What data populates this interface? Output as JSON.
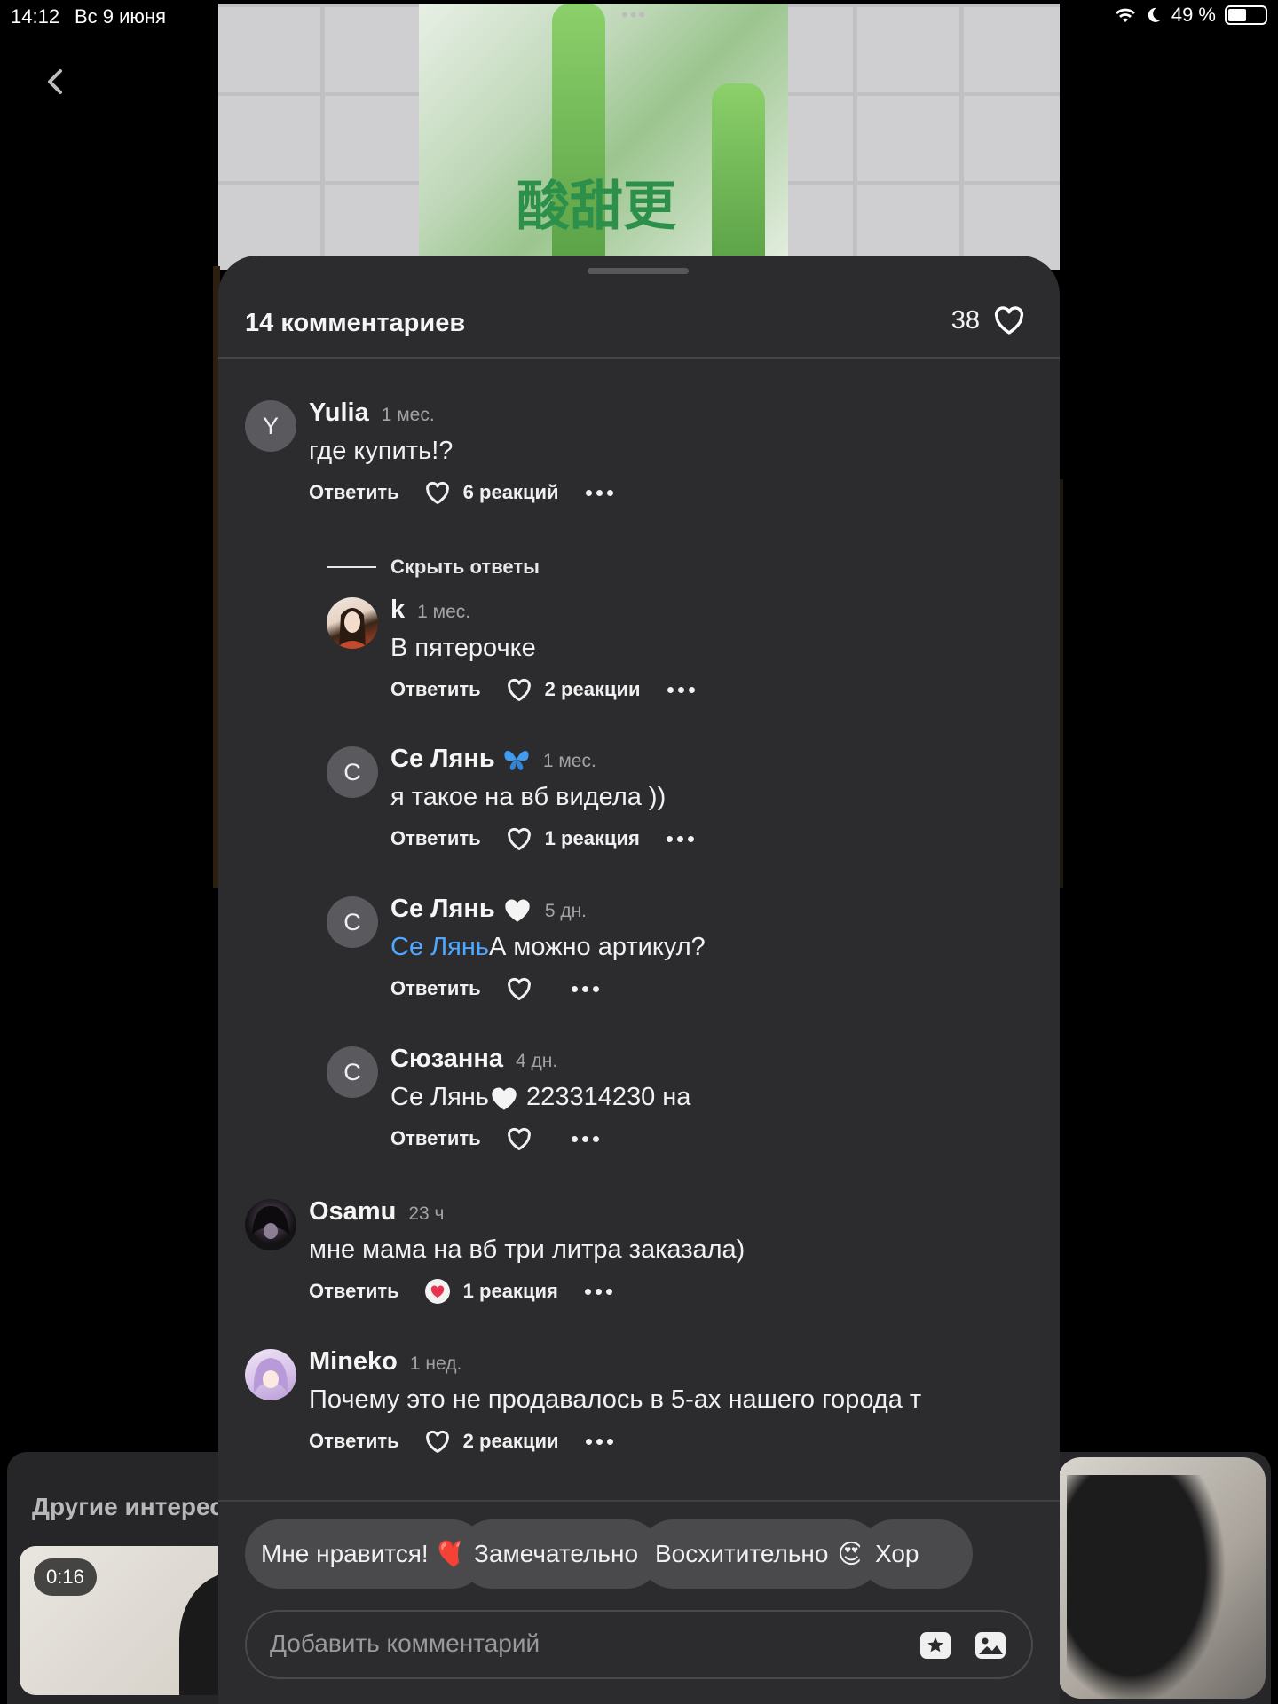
{
  "status_bar": {
    "time": "14:12",
    "date": "Вс 9 июня",
    "battery": "49 %"
  },
  "comments_sheet": {
    "title": "14 комментариев",
    "likes": "38",
    "hide_replies": "Скрыть ответы",
    "reply_label": "Ответить",
    "comments": [
      {
        "author": "Yulia",
        "avatar_letter": "Y",
        "time": "1 мес.",
        "text": "где купить!?",
        "reactions": "6 реакций"
      },
      {
        "author": "k",
        "time": "1 мес.",
        "text": "В пятерочке",
        "reactions": "2 реакции"
      },
      {
        "author": "Се Лянь",
        "avatar_letter": "С",
        "time": "1 мес.",
        "text": "я такое на вб видела ))",
        "reactions": "1 реакция"
      },
      {
        "author": "Се Лянь",
        "avatar_letter": "С",
        "time": "5 дн.",
        "mention": "Се Лянь",
        "text": "А можно артикул?",
        "reactions": ""
      },
      {
        "author": "Сюзанна",
        "avatar_letter": "С",
        "time": "4 дн.",
        "text_prefix": "Се Лянь",
        "text": " 223314230 на",
        "reactions": ""
      },
      {
        "author": "Osamu",
        "time": "23 ч",
        "text": "мне мама на вб три литра заказала)",
        "reactions": "1 реакция"
      },
      {
        "author": "Mineko",
        "time": "1 нед.",
        "text": "Почему это не продавалось в 5-ах нашего города т",
        "reactions": "2 реакции"
      }
    ]
  },
  "quick_reactions": [
    {
      "label": "Мне нравится!",
      "emoji": "❤️"
    },
    {
      "label": "Замечательно!"
    },
    {
      "label": "Восхитительно",
      "emoji": "😍"
    },
    {
      "label": "Хор"
    }
  ],
  "comment_input": {
    "placeholder": "Добавить комментарий"
  },
  "other_section": {
    "title": "Другие интерес",
    "duration": "0:16"
  },
  "colors": {
    "sheet_bg": "#2c2c2e",
    "mention": "#4fa8ff",
    "chip_bg": "#4a4a4d"
  }
}
